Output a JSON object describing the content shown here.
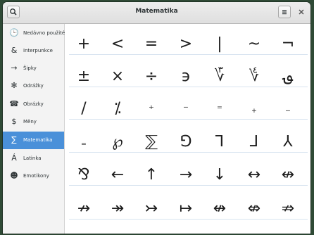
{
  "window": {
    "title": "Matematika"
  },
  "header": {
    "search_icon": "search-icon",
    "menu_icon": "hamburger-menu-icon",
    "close_icon": "close-icon"
  },
  "sidebar": {
    "items": [
      {
        "label": "Nedávno použité",
        "icon": "🕒",
        "name": "recent"
      },
      {
        "label": "Interpunkce",
        "icon": "&",
        "name": "punctuation"
      },
      {
        "label": "Šipky",
        "icon": "→",
        "name": "arrows"
      },
      {
        "label": "Odrážky",
        "icon": "✻",
        "name": "bullets"
      },
      {
        "label": "Obrázky",
        "icon": "☎",
        "name": "pictures"
      },
      {
        "label": "Měny",
        "icon": "$",
        "name": "currency"
      },
      {
        "label": "Matematika",
        "icon": "∑",
        "name": "math",
        "active": true
      },
      {
        "label": "Latinka",
        "icon": "Á",
        "name": "latin"
      },
      {
        "label": "Emotikony",
        "icon": "☻",
        "name": "emoticons"
      }
    ],
    "active_color": "#4a90d9"
  },
  "characters": [
    [
      "+",
      "<",
      "=",
      ">",
      "|",
      "~",
      "¬"
    ],
    [
      "±",
      "×",
      "÷",
      "϶",
      "؆",
      "؇",
      "؈"
    ],
    [
      "/",
      "⁒",
      "⁺",
      "⁻",
      "⁼",
      "₊",
      "₋"
    ],
    [
      "₌",
      "℘",
      "⅀",
      "⅁",
      "⅂",
      "⅃",
      "⅄"
    ],
    [
      "⅋",
      "←",
      "↑",
      "→",
      "↓",
      "↔",
      "↮"
    ],
    [
      "↛",
      "↠",
      "↣",
      "↦",
      "↮",
      "⇎",
      "⇏"
    ]
  ]
}
